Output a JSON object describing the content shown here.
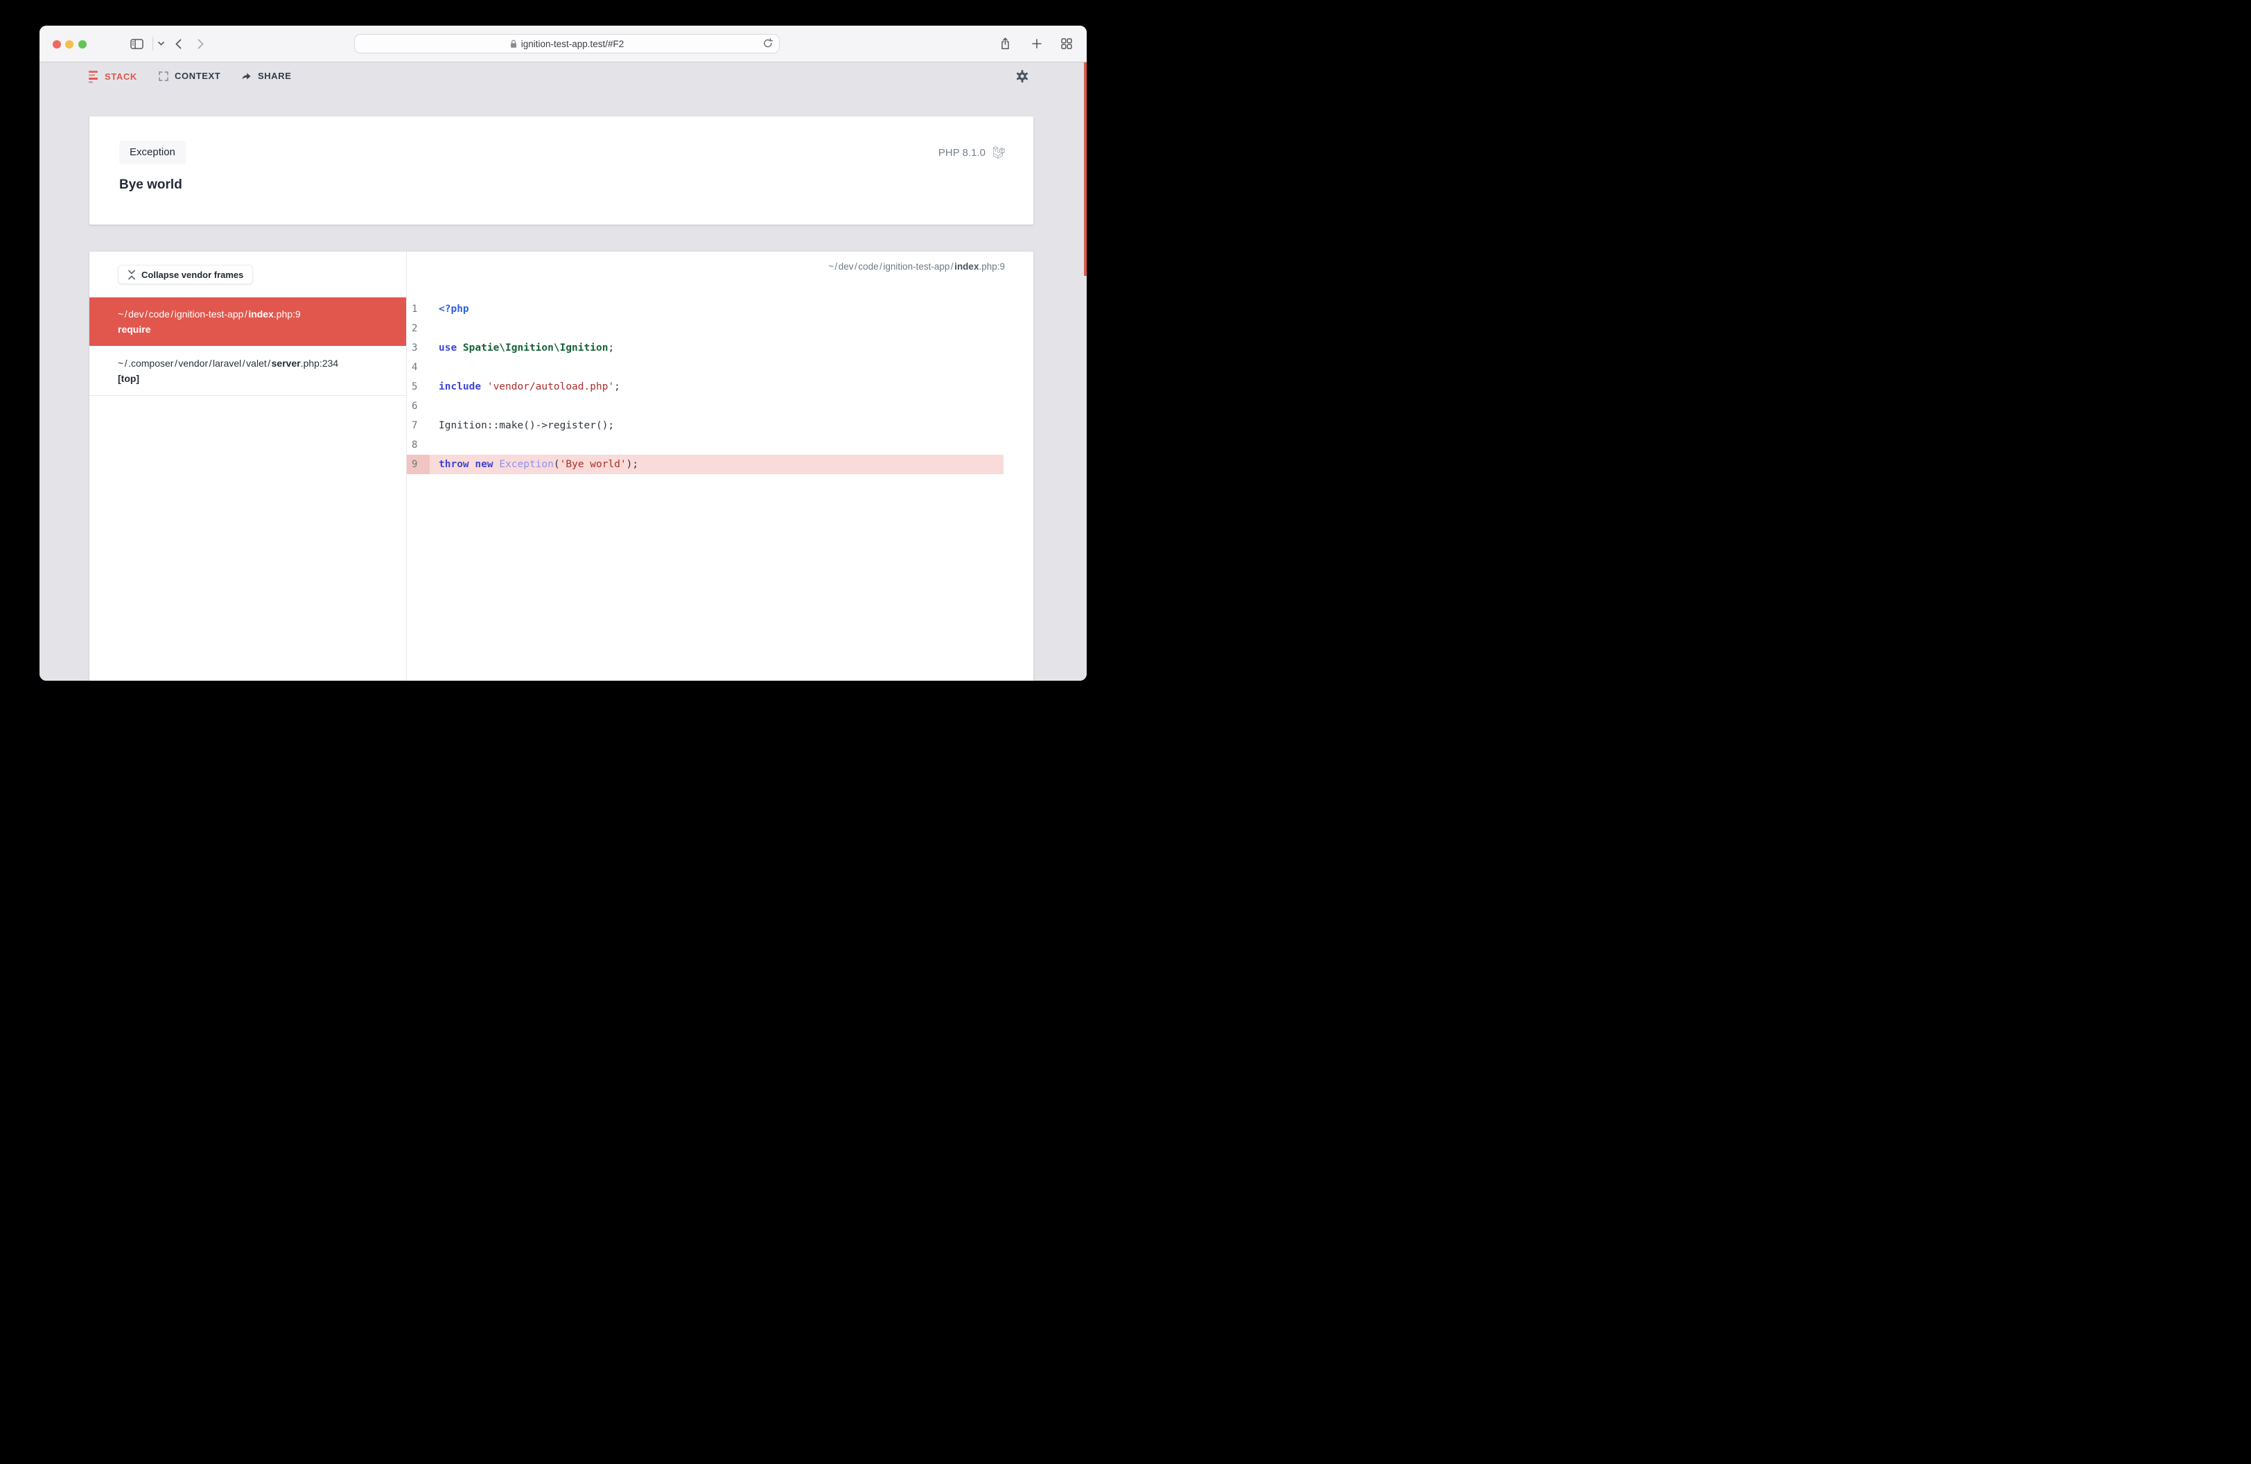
{
  "colors": {
    "accent_red": "#E1574D",
    "scrollbar_red": "#DC5B52",
    "highlight_line_bg": "#F9DBD9",
    "highlight_gutter_bg": "#F1C5C1",
    "traffic_red": "#ED6A5F",
    "traffic_yellow": "#F5BF4F",
    "traffic_green": "#61C555"
  },
  "browser": {
    "url": "ignition-test-app.test/#F2"
  },
  "nav": {
    "stack": "STACK",
    "context": "CONTEXT",
    "share": "SHARE"
  },
  "error": {
    "badge": "Exception",
    "message": "Bye world",
    "php_version": "PHP 8.1.0"
  },
  "stack_panel": {
    "collapse_button": "Collapse vendor frames",
    "frames": [
      {
        "active": true,
        "path_parts": [
          {
            "t": "~/dev/code/ignition-test-app/"
          },
          {
            "t": "index",
            "b": true
          },
          {
            "t": ".php:9"
          }
        ],
        "method": "require"
      },
      {
        "active": false,
        "path_parts": [
          {
            "t": "~/.composer/vendor/laravel/valet/"
          },
          {
            "t": "server",
            "b": true
          },
          {
            "t": ".php:234"
          }
        ],
        "method": "[top]"
      }
    ]
  },
  "code_panel": {
    "header_path_parts": [
      {
        "t": "~/dev/code/ignition-test-app/"
      },
      {
        "t": "index",
        "b": true
      },
      {
        "t": ".php:9"
      }
    ],
    "lines": [
      {
        "no": 1,
        "tokens": [
          {
            "t": "<?php",
            "c": "tag"
          }
        ]
      },
      {
        "no": 2,
        "tokens": []
      },
      {
        "no": 3,
        "tokens": [
          {
            "t": "use ",
            "c": "kw"
          },
          {
            "t": "Spatie\\Ignition\\Ignition",
            "c": "cls"
          },
          {
            "t": ";",
            "c": "pln"
          }
        ]
      },
      {
        "no": 4,
        "tokens": []
      },
      {
        "no": 5,
        "tokens": [
          {
            "t": "include ",
            "c": "kw"
          },
          {
            "t": "'vendor/autoload.php'",
            "c": "str"
          },
          {
            "t": ";",
            "c": "pln"
          }
        ]
      },
      {
        "no": 6,
        "tokens": []
      },
      {
        "no": 7,
        "tokens": [
          {
            "t": "Ignition::make()->register();",
            "c": "pln"
          }
        ]
      },
      {
        "no": 8,
        "tokens": []
      },
      {
        "no": 9,
        "highlight": true,
        "tokens": [
          {
            "t": "throw",
            "c": "kw"
          },
          {
            "t": " ",
            "c": "pln"
          },
          {
            "t": "new",
            "c": "kw"
          },
          {
            "t": " ",
            "c": "pln"
          },
          {
            "t": "Exception",
            "c": "cls2"
          },
          {
            "t": "(",
            "c": "pln"
          },
          {
            "t": "'Bye world'",
            "c": "str"
          },
          {
            "t": ");",
            "c": "pln"
          }
        ]
      }
    ]
  }
}
